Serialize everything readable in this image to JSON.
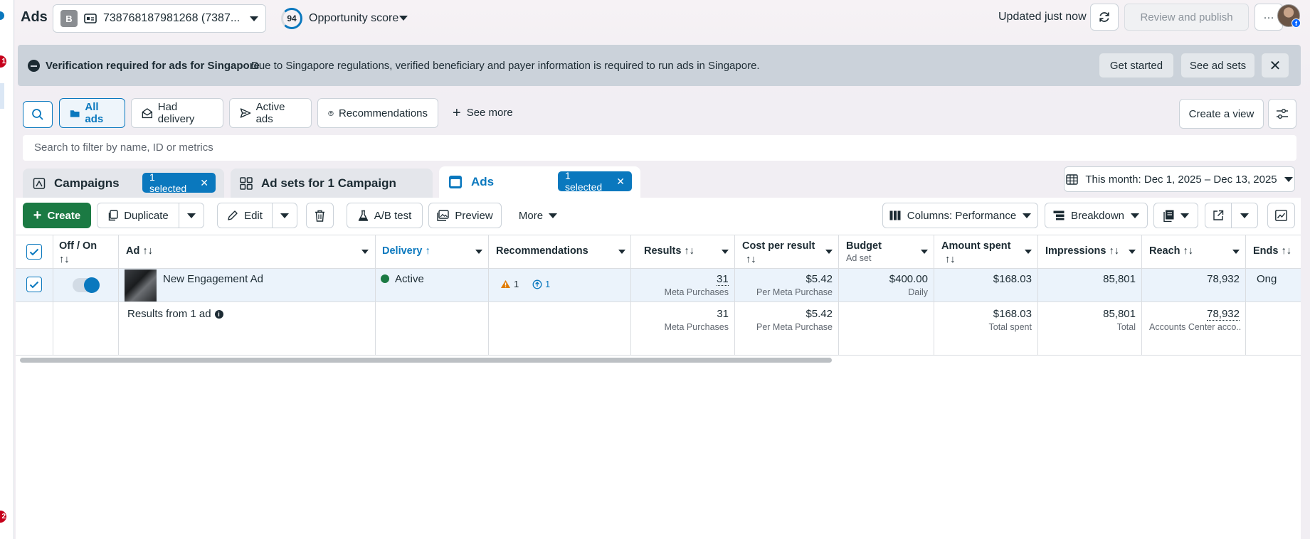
{
  "app": {
    "title": "Ads"
  },
  "account": {
    "badge": "B",
    "name": "738768187981268 (7387..."
  },
  "opportunity": {
    "score": "94",
    "label": "Opportunity score"
  },
  "topbar": {
    "updated": "Updated just now",
    "review_publish": "Review and publish",
    "more": "···"
  },
  "banner": {
    "title": "Verification required for ads for Singapore",
    "text": "Due to Singapore regulations, verified beneficiary and payer information is required to run ads in Singapore.",
    "get_started": "Get started",
    "see_ad_sets": "See ad sets",
    "close": "✕"
  },
  "views": {
    "chips": [
      "All ads",
      "Had delivery",
      "Active ads",
      "Recommendations"
    ],
    "see_more": "See more",
    "create_view": "Create a view"
  },
  "search": {
    "placeholder": "Search to filter by name, ID or metrics"
  },
  "level_tabs": {
    "campaigns": "Campaigns",
    "campaigns_selected": "1 selected",
    "adsets": "Ad sets for 1 Campaign",
    "ads": "Ads",
    "ads_selected": "1 selected",
    "pill_close": "✕"
  },
  "date_range": "This month: Dec 1, 2025 – Dec 13, 2025",
  "toolbar": {
    "create": "Create",
    "duplicate": "Duplicate",
    "edit": "Edit",
    "ab_test": "A/B test",
    "preview": "Preview",
    "more": "More",
    "columns": "Columns: Performance",
    "breakdown": "Breakdown"
  },
  "table": {
    "headers": {
      "offon": "Off / On",
      "sort": "↑↓",
      "ad": "Ad ↑↓",
      "delivery": "Delivery ↑",
      "recommendations": "Recommendations",
      "results": "Results ↑↓",
      "cost": "Cost per result",
      "budget": "Budget",
      "budget_sub": "Ad set",
      "amount": "Amount spent",
      "impressions": "Impressions ↑↓",
      "reach": "Reach ↑↓",
      "ends": "Ends ↑↓"
    },
    "row": {
      "name": "New Engagement Ad",
      "delivery": "Active",
      "warn_count": "1",
      "rec_count": "1",
      "results": "31",
      "results_sub": "Meta Purchases",
      "cost": "$5.42",
      "cost_sub": "Per Meta Purchase",
      "budget": "$400.00",
      "budget_sub": "Daily",
      "amount": "$168.03",
      "impressions": "85,801",
      "reach": "78,932",
      "ends": "Ong"
    },
    "summary": {
      "label": "Results from 1 ad",
      "results": "31",
      "results_sub": "Meta Purchases",
      "cost": "$5.42",
      "cost_sub": "Per Meta Purchase",
      "amount": "$168.03",
      "amount_sub": "Total spent",
      "impressions": "85,801",
      "impressions_sub": "Total",
      "reach": "78,932",
      "reach_sub": "Accounts Center acco..."
    }
  },
  "colors": {
    "accent": "#0a78be",
    "create_green": "#1b7a43",
    "warning": "#e07b00",
    "status_active": "#1b7a43"
  }
}
